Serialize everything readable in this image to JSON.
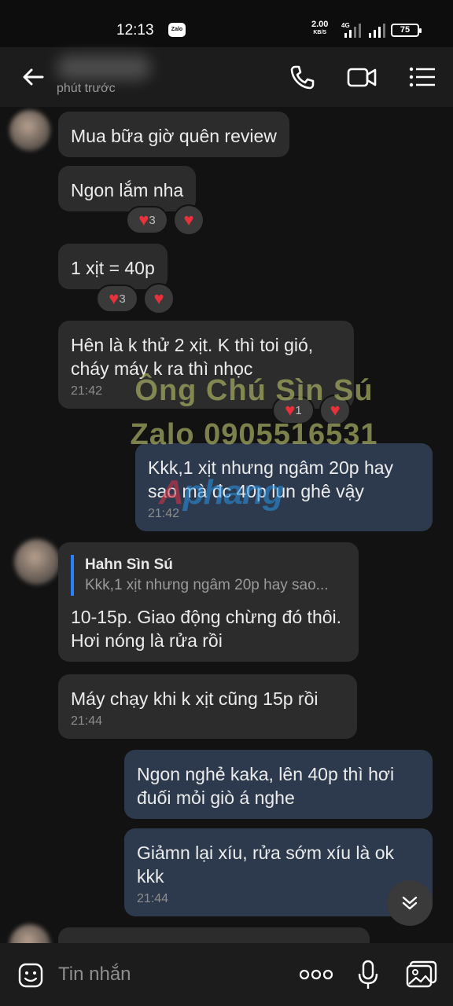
{
  "status_bar": {
    "time": "12:13",
    "app_badge": "Zalo",
    "net_speed_value": "2.00",
    "net_speed_unit": "KB/S",
    "network": "4G",
    "battery": "75"
  },
  "header": {
    "status": "phút trước",
    "icons": [
      "back-arrow-icon",
      "phone-icon",
      "video-call-icon",
      "menu-icon"
    ]
  },
  "messages": [
    {
      "side": "in",
      "text": "Mua bữa giờ quên review"
    },
    {
      "side": "in",
      "text": "Ngon lắm nha",
      "reaction_count": "3"
    },
    {
      "side": "in",
      "text": "1 xịt = 40p",
      "reaction_count": "3"
    },
    {
      "side": "in",
      "text": "Hên là k thử 2 xịt. K thì toi gió, cháy máy k ra thì nhọc",
      "time": "21:42",
      "reaction_count": "1"
    },
    {
      "side": "out",
      "text": "Kkk,1 xịt nhưng ngâm 20p hay sao mà đc 40p lun ghê vậy",
      "time": "21:42"
    },
    {
      "side": "in",
      "quote_name": "Hahn Sìn Sú",
      "quote_text": "Kkk,1 xịt nhưng ngâm 20p hay sao...",
      "text": "10-15p. Giao động chừng đó thôi. Hơi nóng là rửa rồi"
    },
    {
      "side": "in",
      "text": "Máy chạy khi k xịt cũng 15p rồi",
      "time": "21:44"
    },
    {
      "side": "out",
      "text": "Ngon nghẻ kaka, lên 40p thì hơi đuối mỏi giò á nghe"
    },
    {
      "side": "out",
      "text": "Giảmn lại xíu, rửa sớm xíu là ok kkk",
      "time": "21:44"
    }
  ],
  "watermark": {
    "line1": "Ông Chú Sìn Sú",
    "line2": "Zalo 0905516531",
    "logo_part1": "A",
    "logo_part2": "phang"
  },
  "input": {
    "placeholder": "Tin nhắn"
  },
  "colors": {
    "background": "#121212",
    "incoming_bubble": "#2c2c2c",
    "outgoing_bubble": "#2d3a4e",
    "reaction_heart": "#e8313a",
    "quote_bar": "#2d7ff9"
  }
}
